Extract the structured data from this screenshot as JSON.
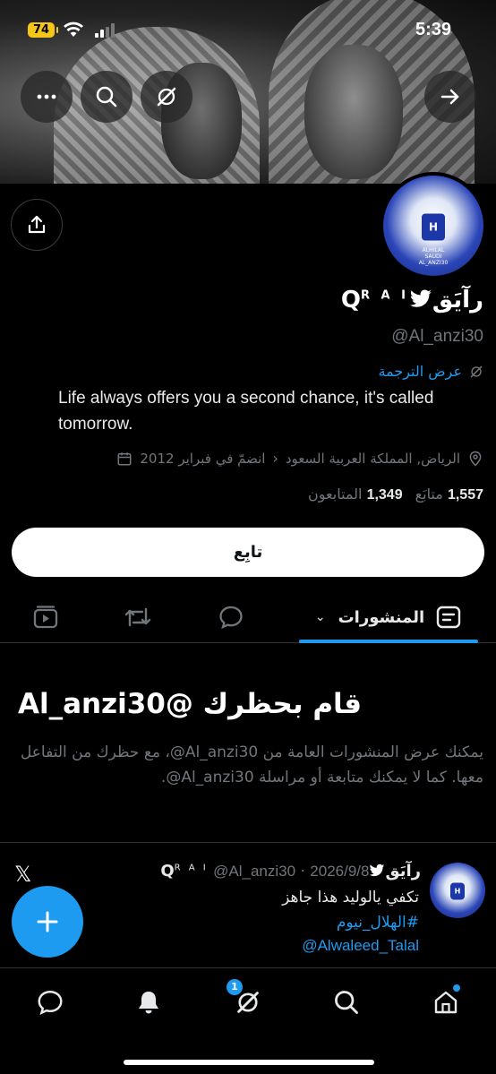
{
  "status_bar": {
    "battery": "74",
    "time": "5:39"
  },
  "profile": {
    "name": "رآيَق",
    "name_q": "Q",
    "name_super": "R A I",
    "handle": "@Al_anzi30",
    "translate_label": "عرض الترجمة",
    "bio": "Life always offers you a second chance, it's called tomorrow.",
    "location": "الرياض, المملكة العربية السعود",
    "joined": "انضمّ في فبراير 2012",
    "following_count": "1,557",
    "following_label": "متابَع",
    "followers_count": "1,349",
    "followers_label": "المتابعون",
    "follow_label": "تابِع",
    "avatar_logo_letter": "H",
    "avatar_logo_text": "ALHILAL\nSAUDI\nAL_ANZI30"
  },
  "tabs": {
    "posts_label": "المنشورات"
  },
  "blocked": {
    "title": "قام بحظرك @Al_anzi30",
    "body": "يمكنك عرض المنشورات العامة من ‎@Al_anzi30‏، مع حظرك من التفاعل معها. كما لا يمكنك متابعة أو مراسلة ‎@Al_anzi30‏."
  },
  "post": {
    "author": "رآيَق",
    "author_q": "Q",
    "author_super": "R A I",
    "handle": "@Al_anzi30",
    "date": "2026/9/8",
    "text": "تكفي يالوليد  هذا جاهز",
    "hashtag": "#الهلال_نيوم",
    "mention": "@Alwaleed_Talal",
    "x_logo": "𝕏"
  },
  "bottom_nav": {
    "notifications_badge": "1"
  },
  "colors": {
    "accent": "#1d9bf0",
    "background": "#000000",
    "muted": "#71767b"
  }
}
